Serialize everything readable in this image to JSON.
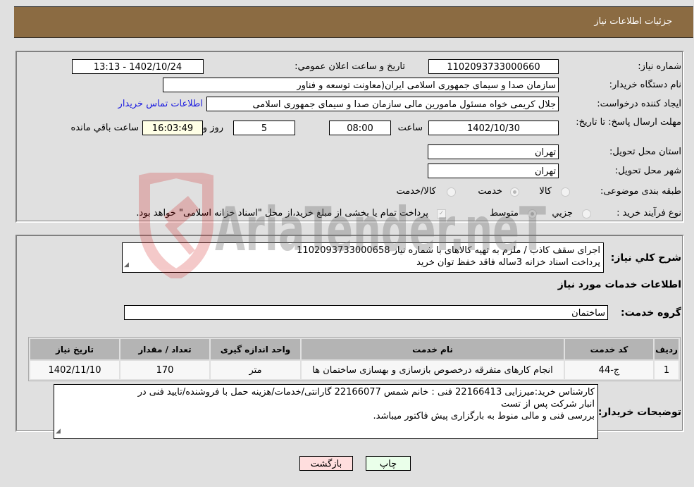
{
  "header": {
    "title": "جزئيات اطلاعات نياز"
  },
  "form": {
    "need_number_label": "شماره نياز:",
    "need_number": "1102093733000660",
    "announce_label": "تاريخ و ساعت اعلان عمومي:",
    "announce_value": "1402/10/24 - 13:13",
    "buyer_org_label": "نام دستگاه خريدار:",
    "buyer_org": "سازمان صدا و سیمای جمهوری اسلامی ایران(معاونت توسعه و فناور",
    "creator_label": "ايجاد كننده درخواست:",
    "creator": "جلال کریمی خواه مسئول مامورین مالی  سازمان صدا و سیمای جمهوری اسلامی",
    "contact_link": "اطلاعات تماس خريدار",
    "deadline_label": "مهلت ارسال پاسخ: تا تاريخ:",
    "deadline_date": "1402/10/30",
    "time_label": "ساعت",
    "deadline_time": "08:00",
    "days_value": "5",
    "days_label": "روز و",
    "remaining_time": "16:03:49",
    "remaining_label": "ساعت باقي مانده",
    "province_label": "استان محل تحويل:",
    "province": "تهران",
    "city_label": "شهر محل تحويل:",
    "city": "تهران",
    "category_label": "طبقه بندی موضوعی:",
    "category_options": [
      "کالا",
      "خدمت",
      "کالا/خدمت"
    ],
    "category_selected": "خدمت",
    "purchase_type_label": "نوع فرآیند خرید :",
    "purchase_type_options": [
      "جزيي",
      "متوسط"
    ],
    "purchase_type_selected": "متوسط",
    "treasury_note": "پرداخت تمام يا بخشی از مبلغ خريد،از محل \"اسناد خزانه اسلامی\" خواهد بود.",
    "treasury_checked": true
  },
  "details": {
    "summary_label": "شرح كلي نياز:",
    "summary_lines": [
      "اجرای سقف کاذب / ملزم به تهیه کالاهای با شماره نیاز 1102093733000658",
      "پرداخت اسناد خزانه 3ساله فاقد خفظ توان خرید"
    ],
    "services_heading": "اطلاعات خدمات مورد نياز",
    "service_group_label": "گروه خدمت:",
    "service_group": "ساختمان",
    "table": {
      "headers": [
        "رديف",
        "كد خدمت",
        "نام خدمت",
        "واحد اندازه گيری",
        "تعداد / مقدار",
        "تاريخ نياز"
      ],
      "rows": [
        [
          "1",
          "ج-44",
          "انجام کارهای متفرقه درخصوص بازسازی و بهسازی ساختمان ها",
          "متر",
          "170",
          "1402/11/10"
        ]
      ]
    },
    "buyer_notes_label": "توضيحات خريدار:",
    "buyer_notes_lines": [
      "کارشناس خرید:میرزایی 22166413   فنی : خانم شمس 22166077 گارانتی/خدمات/هزینه حمل با فروشنده/تایید فنی در",
      "انبار شرکت پس از تست",
      "بررسی فنی و مالی منوط به بارگزاری پیش فاکتور میباشد."
    ]
  },
  "buttons": {
    "print": "چاپ",
    "back": "بازگشت"
  },
  "watermark": {
    "text": "AriaTender.neT"
  }
}
